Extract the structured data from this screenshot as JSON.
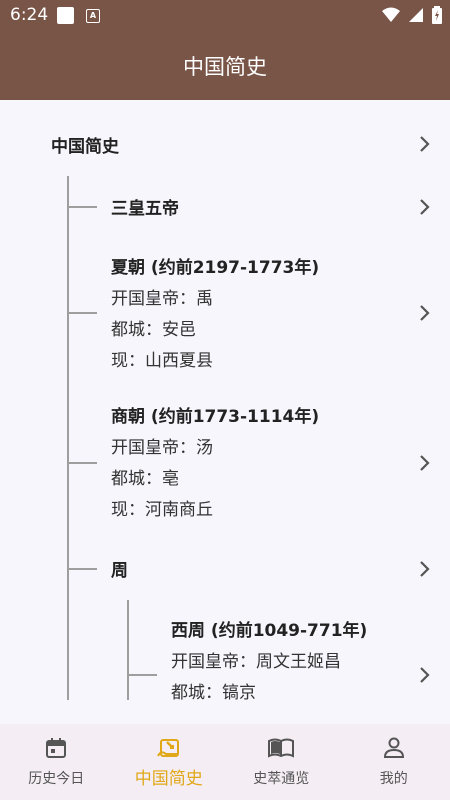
{
  "status": {
    "time": "6:24"
  },
  "appbar": {
    "title": "中国简史"
  },
  "root": {
    "label": "中国简史"
  },
  "items": [
    {
      "title": "三皇五帝",
      "lines": []
    },
    {
      "title": "夏朝 (约前2197-1773年)",
      "lines": [
        "开国皇帝：禹",
        "都城：安邑",
        "现：山西夏县"
      ]
    },
    {
      "title": "商朝 (约前1773-1114年)",
      "lines": [
        "开国皇帝：汤",
        "都城：亳",
        "现：河南商丘"
      ]
    },
    {
      "title": "周",
      "lines": []
    }
  ],
  "sub_items": [
    {
      "title": "西周 (约前1049-771年)",
      "lines": [
        "开国皇帝：周文王姬昌",
        "都城：镐京"
      ]
    }
  ],
  "nav": [
    {
      "label": "历史今日",
      "icon": "calendar-icon"
    },
    {
      "label": "中国简史",
      "icon": "scroll-icon"
    },
    {
      "label": "史萃通览",
      "icon": "book-icon"
    },
    {
      "label": "我的",
      "icon": "person-icon"
    }
  ],
  "colors": {
    "primary": "#795548",
    "accent": "#e0a818"
  }
}
